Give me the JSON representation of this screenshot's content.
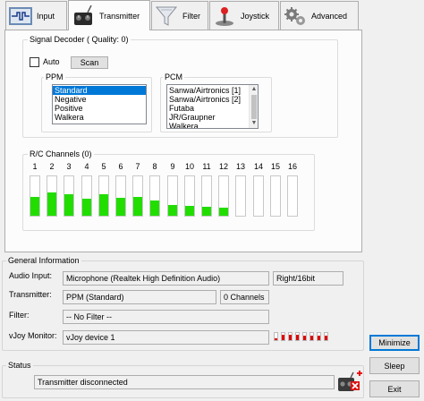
{
  "tabs": [
    {
      "label": "Input",
      "icon": "input-icon"
    },
    {
      "label": "Transmitter",
      "icon": "transmitter-icon"
    },
    {
      "label": "Filter",
      "icon": "filter-icon"
    },
    {
      "label": "Joystick",
      "icon": "joystick-icon"
    },
    {
      "label": "Advanced",
      "icon": "gears-icon"
    }
  ],
  "active_tab": "Transmitter",
  "decoder": {
    "title": "Signal Decoder ( Quality: 0)",
    "auto_label": "Auto",
    "auto_checked": false,
    "scan_label": "Scan",
    "ppm_title": "PPM",
    "ppm_items": [
      "Standard",
      "Negative",
      "Positive",
      "Walkera"
    ],
    "ppm_selected": "Standard",
    "pcm_title": "PCM",
    "pcm_items": [
      "Sanwa/Airtronics [1]",
      "Sanwa/Airtronics [2]",
      "Futaba",
      "JR/Graupner",
      "Walkera"
    ]
  },
  "channels": {
    "title": "R/C Channels (0)",
    "labels": [
      "1",
      "2",
      "3",
      "4",
      "5",
      "6",
      "7",
      "8",
      "9",
      "10",
      "11",
      "12",
      "13",
      "14",
      "15",
      "16"
    ],
    "levels": [
      0.48,
      0.58,
      0.54,
      0.44,
      0.54,
      0.46,
      0.47,
      0.38,
      0.28,
      0.25,
      0.22,
      0.2,
      0,
      0,
      0,
      0
    ],
    "bar_color": "#22dd00"
  },
  "general": {
    "title": "General Information",
    "audio_label": "Audio Input:",
    "audio_value": "Microphone (Realtek High Definition Audio)",
    "audio_format": "Right/16bit",
    "transmitter_label": "Transmitter:",
    "transmitter_value": "PPM (Standard)",
    "channel_count": "0 Channels",
    "filter_label": "Filter:",
    "filter_value": "-- No Filter --",
    "vjoy_label": "vJoy Monitor:",
    "vjoy_value": "vJoy device 1",
    "vjoy_levels": [
      0.25,
      0.8,
      0.8,
      0.8,
      0.6,
      0.6,
      0.6,
      0.6
    ],
    "vjoy_color": "#e00000"
  },
  "status": {
    "title": "Status",
    "value": "Transmitter disconnected"
  },
  "buttons": {
    "minimize": "Minimize",
    "sleep": "Sleep",
    "exit": "Exit"
  }
}
